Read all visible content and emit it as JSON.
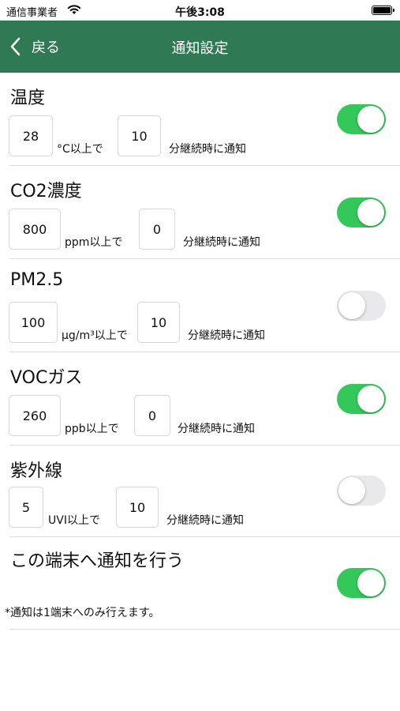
{
  "status_bar": {
    "carrier": "通信事業者",
    "time": "午後3:08"
  },
  "nav": {
    "back_label": "戻る",
    "title": "通知設定"
  },
  "settings": [
    {
      "label": "温度",
      "threshold": "28",
      "unit": "°C以上で",
      "duration": "10",
      "suffix": "分継続時に通知",
      "enabled": true
    },
    {
      "label": "CO2濃度",
      "threshold": "800",
      "unit": "ppm以上で",
      "duration": "0",
      "suffix": "分継続時に通知",
      "enabled": true
    },
    {
      "label": "PM2.5",
      "threshold": "100",
      "unit": "μg/m³以上で",
      "duration": "10",
      "suffix": "分継続時に通知",
      "enabled": false
    },
    {
      "label": "VOCガス",
      "threshold": "260",
      "unit": "ppb以上で",
      "duration": "0",
      "suffix": "分継続時に通知",
      "enabled": true
    },
    {
      "label": "紫外線",
      "threshold": "5",
      "unit": "UVI以上で",
      "duration": "10",
      "suffix": "分継続時に通知",
      "enabled": false
    }
  ],
  "device_notify": {
    "label": "この端末へ通知を行う",
    "enabled": true,
    "note": "*通知は1端末へのみ行えます。"
  }
}
